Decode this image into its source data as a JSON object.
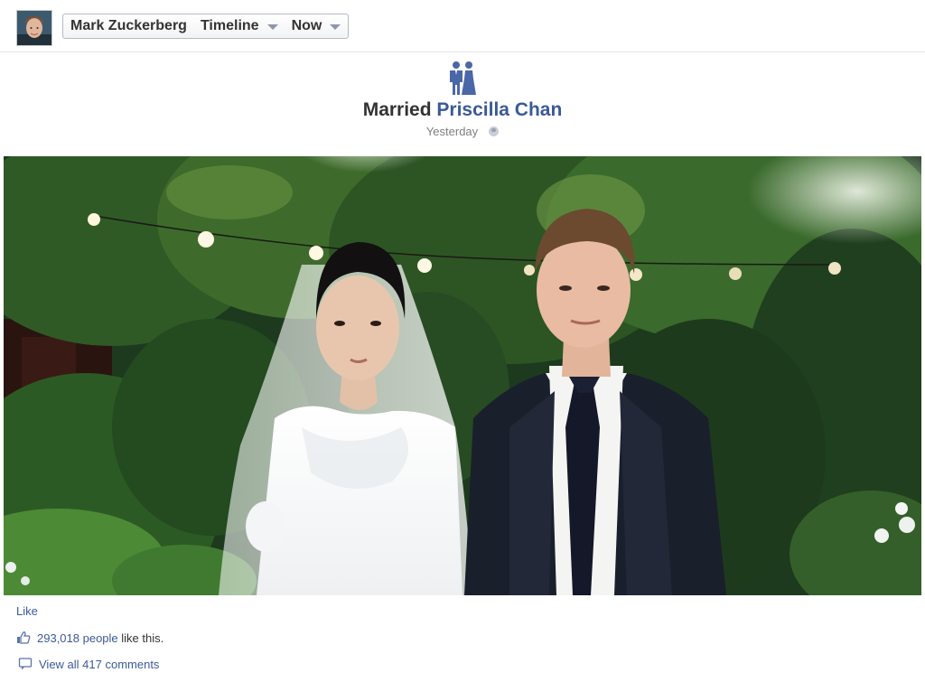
{
  "header": {
    "profile_name": "Mark Zuckerberg",
    "timeline_label": "Timeline",
    "period_label": "Now"
  },
  "event": {
    "icon": "married-couple-icon",
    "prefix": "Married",
    "partner": "Priscilla Chan",
    "time": "Yesterday",
    "privacy_icon": "globe-icon"
  },
  "photo": {
    "subject": "wedding-photo"
  },
  "footer": {
    "like_label": "Like",
    "likes_count": "293,018 people",
    "likes_suffix": "like this.",
    "comments_label": "View all 417 comments"
  },
  "colors": {
    "link": "#3b5998",
    "text": "#333333",
    "muted": "#7f7f7f"
  }
}
